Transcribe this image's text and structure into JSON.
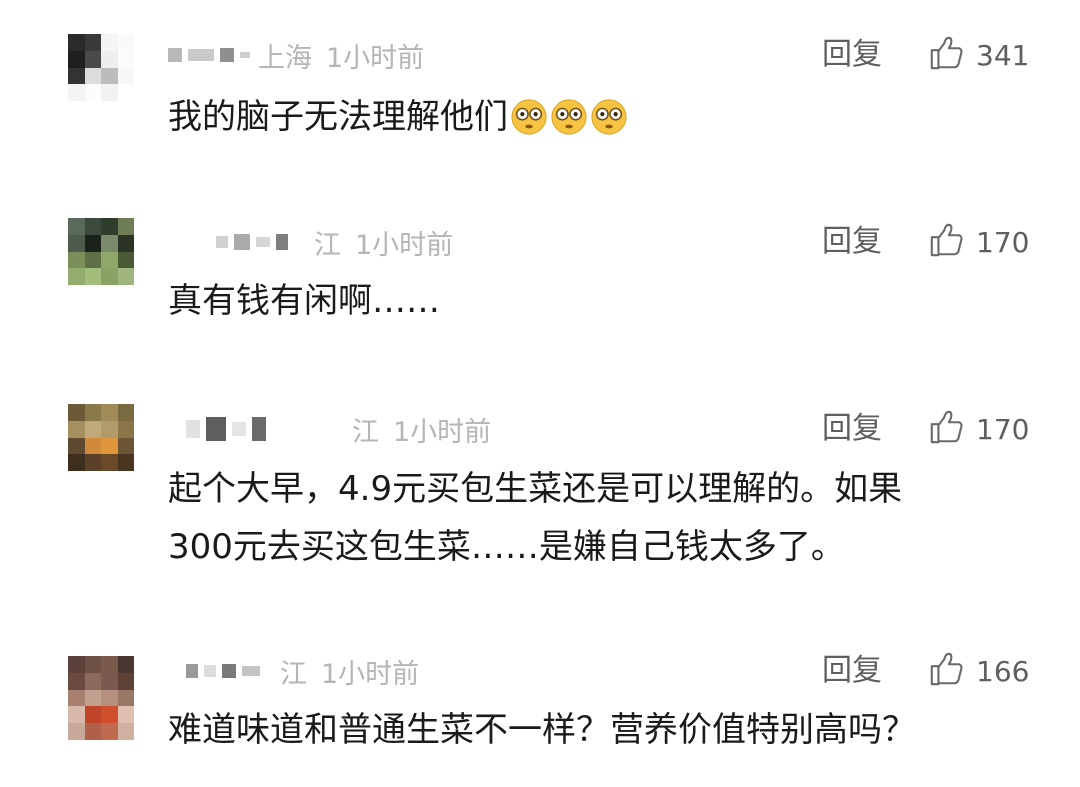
{
  "comments": [
    {
      "location": "上海",
      "time": "1小时前",
      "reply_label": "回复",
      "likes": "341",
      "text": "我的脑子无法理解他们",
      "emoji_count": 3
    },
    {
      "location": "江",
      "time": "1小时前",
      "reply_label": "回复",
      "likes": "170",
      "text": "真有钱有闲啊……"
    },
    {
      "location": "江",
      "time": "1小时前",
      "reply_label": "回复",
      "likes": "170",
      "text_line1": "起个大早，4.9元买包生菜还是可以理解的。如果",
      "text_line2": "300元去买这包生菜……是嫌自己钱太多了。"
    },
    {
      "location": "江",
      "time": "1小时前",
      "reply_label": "回复",
      "likes": "166",
      "text": "难道味道和普通生菜不一样？营养价值特别高吗？"
    }
  ],
  "colors": {
    "meta_text": "#b5b5b5",
    "action_text": "#5f5f5f",
    "body_text": "#1a1a1a",
    "emoji_face": "#f6c343"
  },
  "icons": {
    "like": "thumbs-up-icon",
    "emoji": "flushed-face-emoji"
  }
}
